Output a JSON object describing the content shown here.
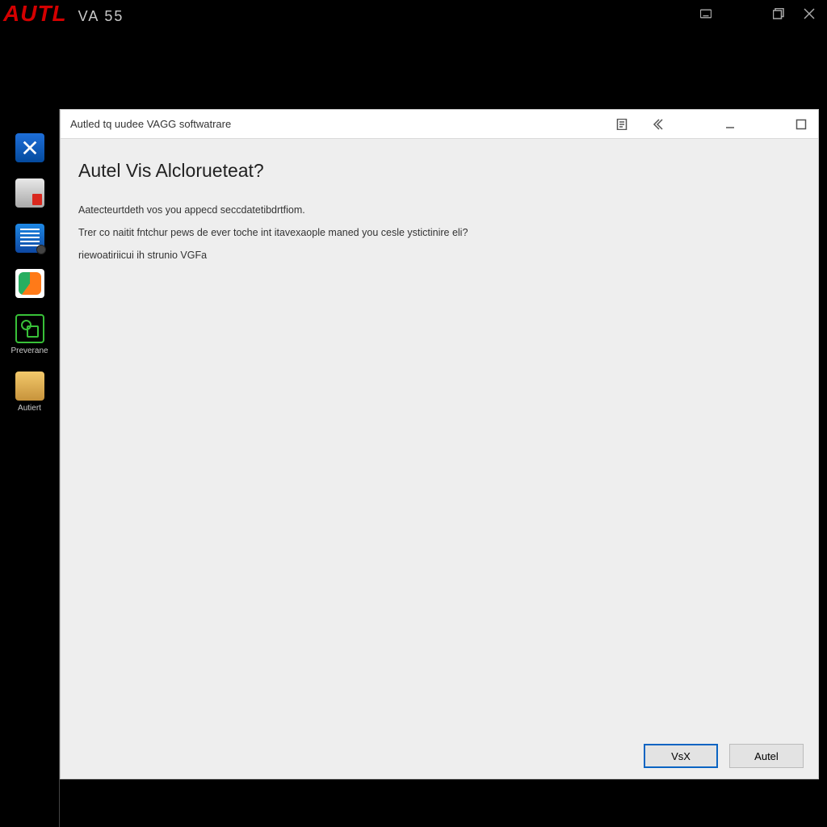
{
  "topbar": {
    "logo": "AUTL",
    "sub": "VA 55"
  },
  "rail": {
    "items": [
      {
        "name": "rail-item-vx",
        "icon_name": "blue-x-icon"
      },
      {
        "name": "rail-item-doc",
        "icon_name": "grey-doc-icon"
      },
      {
        "name": "rail-item-notes",
        "icon_name": "notes-icon"
      },
      {
        "name": "rail-item-palette",
        "icon_name": "orange-swirl-icon"
      },
      {
        "name": "rail-item-preview",
        "icon_name": "green-preview-icon",
        "label": "Preverane"
      },
      {
        "name": "rail-item-autiert",
        "icon_name": "bag-icon",
        "label": "Autiert"
      }
    ]
  },
  "dialog": {
    "title": "Autled tq uudee VAGG softwatrare",
    "heading": "Autel Vis Alclorueteat?",
    "para1": "Aatecteurtdeth vos you appecd seccdatetibdrtfiom.",
    "para2": "Trer co naitit fntchur pews de ever toche int itavexaople maned you cesle ystictinire eli?",
    "para3": "riewoatiriicui ih strunio VGFa",
    "buttons": {
      "primary": "VsX",
      "secondary": "Autel"
    }
  }
}
